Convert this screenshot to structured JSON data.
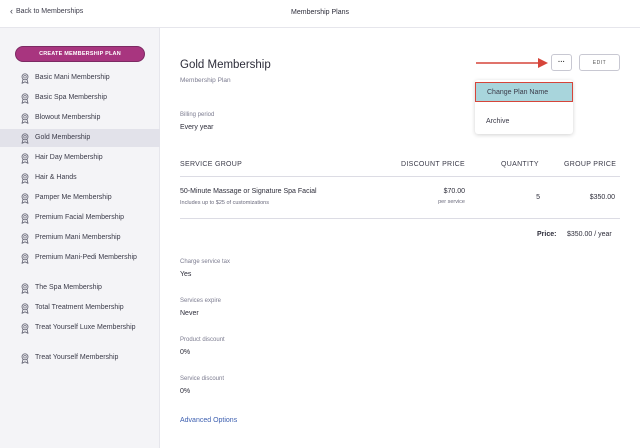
{
  "header": {
    "back_label": "Back to Memberships",
    "title": "Membership Plans"
  },
  "sidebar": {
    "create_label": "CREATE MEMBERSHIP PLAN",
    "items": [
      {
        "label": "Basic Mani Membership"
      },
      {
        "label": "Basic Spa Membership"
      },
      {
        "label": "Blowout Membership"
      },
      {
        "label": "Gold Membership",
        "active": true
      },
      {
        "label": "Hair Day Membership"
      },
      {
        "label": "Hair & Hands"
      },
      {
        "label": "Pamper Me Membership"
      },
      {
        "label": "Premium Facial Membership"
      },
      {
        "label": "Premium Mani Membership"
      },
      {
        "label": "Premium Mani-Pedi Membership"
      },
      {
        "label": "The Spa Membership"
      },
      {
        "label": "Total Treatment Membership"
      },
      {
        "label": "Treat Yourself Luxe Membership"
      },
      {
        "label": "Treat Yourself Membership"
      }
    ]
  },
  "plan": {
    "name": "Gold Membership",
    "type": "Membership Plan",
    "more_label": "···",
    "edit_label": "EDIT",
    "menu": {
      "change_name": "Change Plan Name",
      "archive": "Archive"
    },
    "billing_label": "Billing period",
    "billing_value": "Every year",
    "table": {
      "headers": {
        "service_group": "SERVICE GROUP",
        "discount_price": "DISCOUNT PRICE",
        "quantity": "QUANTITY",
        "group_price": "GROUP PRICE"
      },
      "row": {
        "service": "50-Minute Massage or Signature Spa Facial",
        "note": "Includes up to $25 of customizations",
        "discount_price": "$70.00",
        "per_service": "per service",
        "quantity": "5",
        "group_price": "$350.00"
      }
    },
    "price_label": "Price:",
    "price_value": "$350.00 / year",
    "fields": [
      {
        "label": "Charge service tax",
        "value": "Yes"
      },
      {
        "label": "Services expire",
        "value": "Never"
      },
      {
        "label": "Product discount",
        "value": "0%"
      },
      {
        "label": "Service discount",
        "value": "0%"
      }
    ],
    "advanced_label": "Advanced Options"
  },
  "colors": {
    "primary_button": "#a8357f",
    "menu_highlight": "#a8d5dc",
    "annotation_red": "#d6453a",
    "link": "#3d5fb0"
  },
  "icons": {
    "sidebar_item": "ribbon-badge-icon",
    "back": "chevron-left-icon"
  }
}
